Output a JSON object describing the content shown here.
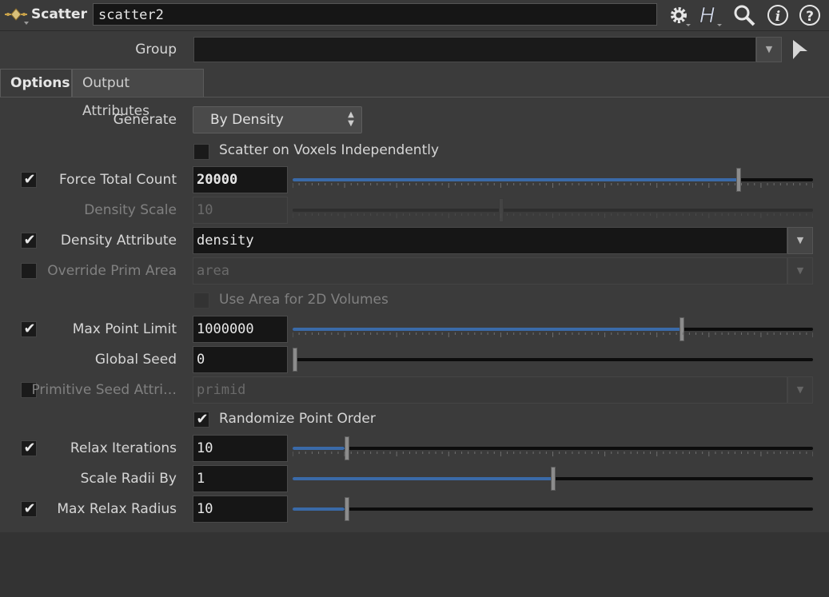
{
  "header": {
    "node_type": "Scatter",
    "node_name": "scatter2"
  },
  "group": {
    "label": "Group",
    "value": ""
  },
  "tabs": [
    {
      "label": "Options",
      "active": true
    },
    {
      "label": "Output Attributes",
      "active": false
    }
  ],
  "generate": {
    "label": "Generate",
    "value": "By Density"
  },
  "scatter_voxels": {
    "label": "Scatter on Voxels Independently",
    "checked": false
  },
  "force_total_count": {
    "label": "Force Total Count",
    "enabled": true,
    "value": "20000",
    "slider_fraction": 0.86
  },
  "density_scale": {
    "label": "Density Scale",
    "value": "10",
    "slider_fraction": 0.4
  },
  "density_attribute": {
    "label": "Density Attribute",
    "enabled": true,
    "value": "density"
  },
  "override_prim_area": {
    "label": "Override Prim Area",
    "enabled": false,
    "value": "area"
  },
  "use_area_2d": {
    "label": "Use Area for 2D Volumes",
    "checked": false
  },
  "max_point_limit": {
    "label": "Max Point Limit",
    "enabled": true,
    "value": "1000000",
    "slider_fraction": 0.75
  },
  "global_seed": {
    "label": "Global Seed",
    "value": "0",
    "slider_fraction": 0.0
  },
  "primitive_seed": {
    "label": "Primitive Seed Attri…",
    "enabled": false,
    "value": "primid"
  },
  "randomize_order": {
    "label": "Randomize Point Order",
    "checked": true
  },
  "relax_iterations": {
    "label": "Relax Iterations",
    "enabled": true,
    "value": "10",
    "slider_fraction": 0.1
  },
  "scale_radii": {
    "label": "Scale Radii By",
    "value": "1",
    "slider_fraction": 0.5
  },
  "max_relax_radius": {
    "label": "Max Relax Radius",
    "enabled": true,
    "value": "10",
    "slider_fraction": 0.1
  },
  "colors": {
    "background": "#3b3b3b",
    "field": "#161616",
    "slider_fill": "#3a6aa8"
  }
}
